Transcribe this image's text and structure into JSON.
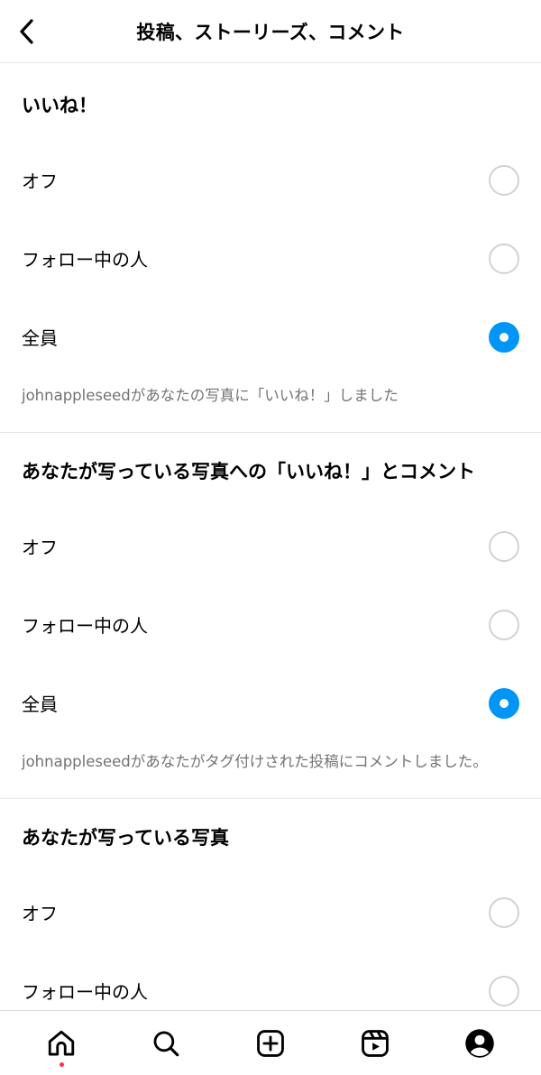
{
  "header": {
    "title": "投稿、ストーリーズ、コメント",
    "back_icon": "chevron-left-icon"
  },
  "sections": [
    {
      "title": "いいね！",
      "options": [
        {
          "label": "オフ",
          "selected": false
        },
        {
          "label": "フォロー中の人",
          "selected": false
        },
        {
          "label": "全員",
          "selected": true
        }
      ],
      "example": "johnappleseedがあなたの写真に「いいね！」しました"
    },
    {
      "title": "あなたが写っている写真への「いいね！」とコメント",
      "options": [
        {
          "label": "オフ",
          "selected": false
        },
        {
          "label": "フォロー中の人",
          "selected": false
        },
        {
          "label": "全員",
          "selected": true
        }
      ],
      "example": "johnappleseedがあなたがタグ付けされた投稿にコメントしました。"
    },
    {
      "title": "あなたが写っている写真",
      "options": [
        {
          "label": "オフ",
          "selected": false
        },
        {
          "label": "フォロー中の人",
          "selected": false
        }
      ]
    }
  ],
  "bottom_nav": {
    "items": [
      "home-icon",
      "search-icon",
      "create-icon",
      "reels-icon",
      "profile-icon"
    ],
    "notification_dot_color": "#ff3040"
  },
  "colors": {
    "accent": "#0095f6",
    "secondary_text": "#737373",
    "divider": "#e6e6e6"
  }
}
